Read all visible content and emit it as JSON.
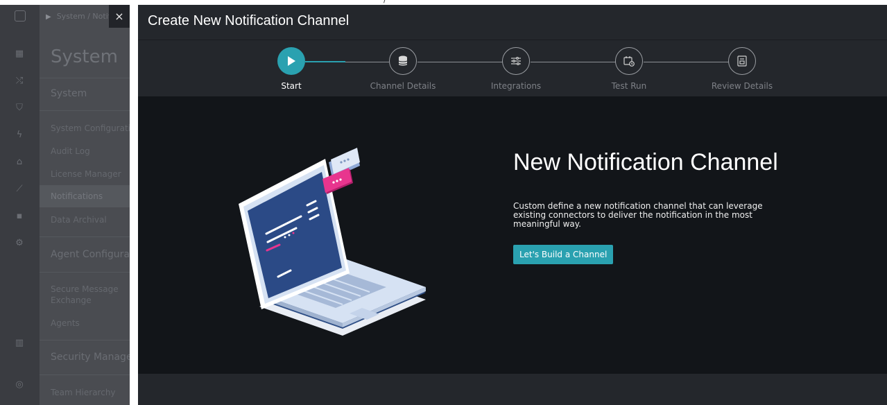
{
  "top_strip": {
    "glyph": "/"
  },
  "background_app": {
    "breadcrumb": "System / Notifications",
    "page_title": "System",
    "sections": [
      {
        "title": "System",
        "items": [
          "System Configuration",
          "Audit Log",
          "License Manager",
          "Notifications",
          "Data Archival"
        ]
      },
      {
        "title": "Agent Configuration",
        "items": [
          "Secure Message Exchange",
          "Agents"
        ]
      },
      {
        "title": "Security Management",
        "items": [
          "Team Hierarchy"
        ]
      }
    ],
    "selected_item": "Notifications"
  },
  "close_button": {
    "label": "×"
  },
  "modal": {
    "title": "Create New Notification Channel",
    "steps": [
      {
        "label": "Start",
        "icon": "play-icon",
        "active": true
      },
      {
        "label": "Channel Details",
        "icon": "database-icon",
        "active": false
      },
      {
        "label": "Integrations",
        "icon": "sliders-icon",
        "active": false
      },
      {
        "label": "Test Run",
        "icon": "calendar-clock-icon",
        "active": false
      },
      {
        "label": "Review Details",
        "icon": "document-icon",
        "active": false
      }
    ],
    "heading": "New Notification Channel",
    "description": "Custom define a new notification channel that can leverage existing connectors to deliver the notification in the most meaningful way.",
    "cta_label": "Let's Build a Channel",
    "illustration": "laptop-with-notification-bubbles"
  },
  "colors": {
    "accent": "#2aa1b0",
    "modal_bg": "#121519",
    "header_bg": "#24272c",
    "pink": "#e8358e"
  }
}
